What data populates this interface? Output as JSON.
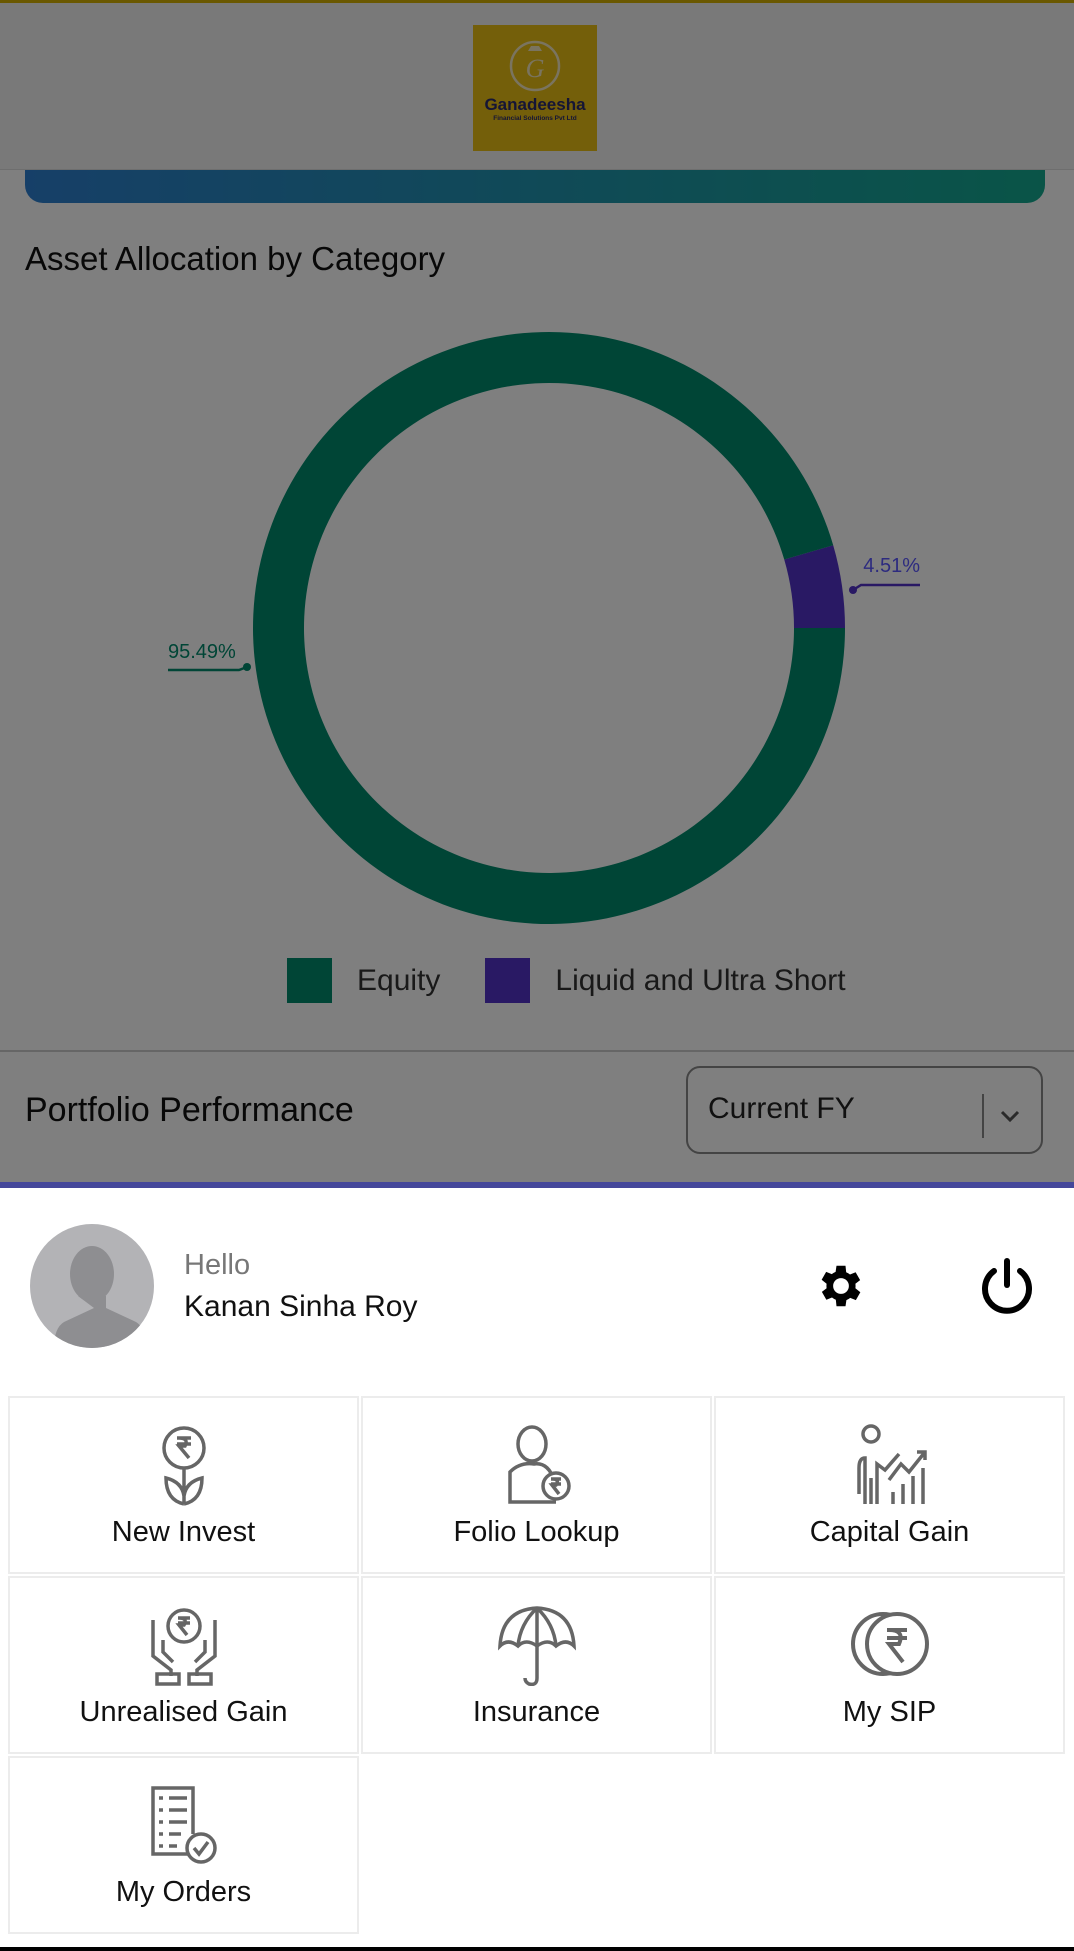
{
  "header": {
    "logo": {
      "name": "Ganadeesha",
      "tagline": "Financial Solutions Pvt Ltd"
    }
  },
  "main": {
    "asset_allocation": {
      "title": "Asset Allocation by Category"
    },
    "portfolio_performance": {
      "title": "Portfolio Performance",
      "period_select": {
        "value": "Current FY"
      }
    }
  },
  "chart_data": {
    "type": "pie",
    "donut": true,
    "categories": [
      "Equity",
      "Liquid and Ultra Short"
    ],
    "values": [
      95.49,
      4.51
    ],
    "data_labels": [
      "95.49%",
      "4.51%"
    ],
    "colors": [
      "#008a6c",
      "#5232c8"
    ],
    "legend": "bottom"
  },
  "sheet": {
    "greeting": "Hello",
    "user_name": "Kanan Sinha Roy",
    "menu": [
      {
        "label": "New Invest",
        "icon": "rupee-plant-icon"
      },
      {
        "label": "Folio Lookup",
        "icon": "user-rupee-icon"
      },
      {
        "label": "Capital Gain",
        "icon": "growth-chart-icon"
      },
      {
        "label": "Unrealised Gain",
        "icon": "hands-rupee-icon"
      },
      {
        "label": "Insurance",
        "icon": "umbrella-icon"
      },
      {
        "label": "My SIP",
        "icon": "rupee-coins-icon"
      },
      {
        "label": "My Orders",
        "icon": "order-list-icon"
      }
    ]
  }
}
